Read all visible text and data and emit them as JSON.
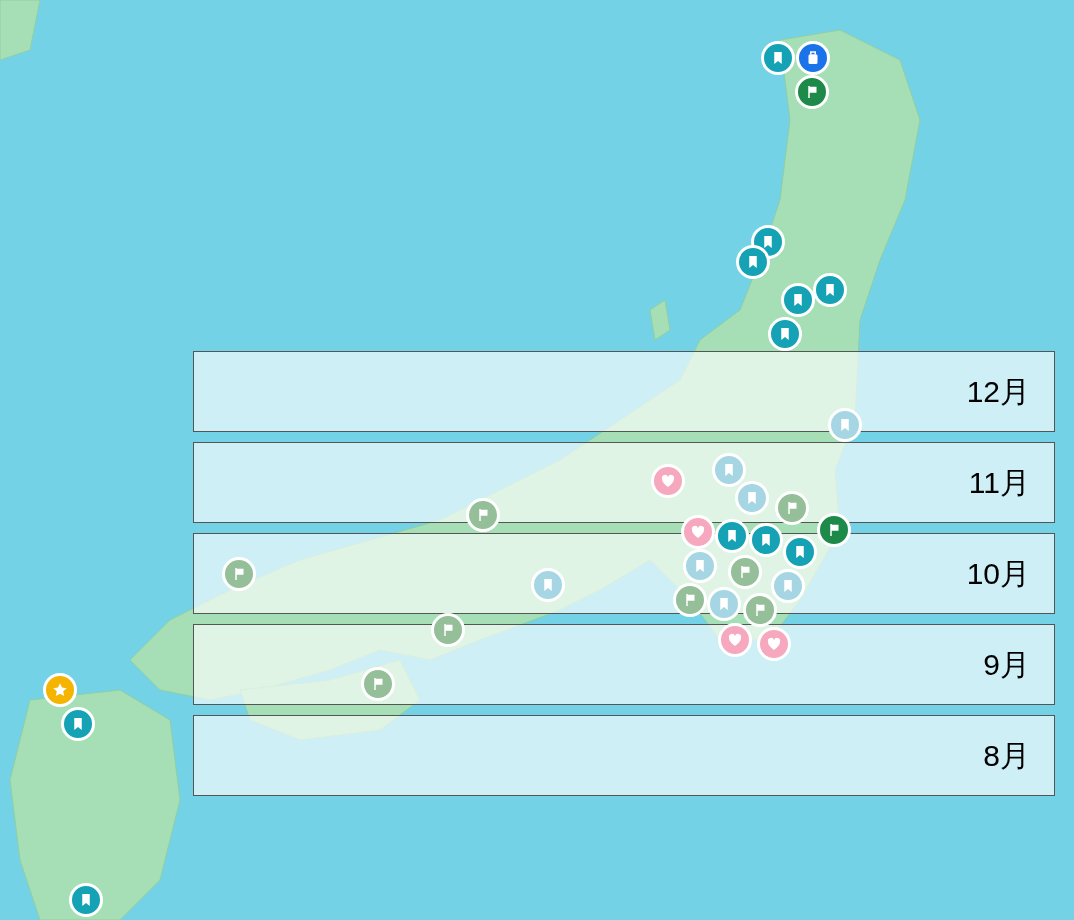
{
  "month_bands": [
    {
      "label": "12月"
    },
    {
      "label": "11月"
    },
    {
      "label": "10月"
    },
    {
      "label": "9月"
    },
    {
      "label": "8月"
    }
  ],
  "pins": [
    {
      "kind": "bookmark",
      "color": "#16a2b5"
    },
    {
      "kind": "flag",
      "color": "#1e8a4a"
    },
    {
      "kind": "suitcase",
      "color": "#1a73e8"
    },
    {
      "kind": "bookmark",
      "color": "#16a2b5"
    },
    {
      "kind": "bookmark",
      "color": "#16a2b5"
    },
    {
      "kind": "bookmark",
      "color": "#16a2b5"
    },
    {
      "kind": "bookmark",
      "color": "#16a2b5"
    },
    {
      "kind": "bookmark",
      "color": "#16a2b5"
    },
    {
      "kind": "bookmark",
      "color": "#a6d6e3"
    },
    {
      "kind": "heart",
      "color": "#f6a8be"
    },
    {
      "kind": "bookmark",
      "color": "#a6d6e3"
    },
    {
      "kind": "bookmark",
      "color": "#a6d6e3"
    },
    {
      "kind": "flag",
      "color": "#94bf99"
    },
    {
      "kind": "flag",
      "color": "#94bf99"
    },
    {
      "kind": "flag",
      "color": "#1e8a4a"
    },
    {
      "kind": "heart",
      "color": "#f6a8be"
    },
    {
      "kind": "bookmark",
      "color": "#16a2b5"
    },
    {
      "kind": "bookmark",
      "color": "#16a2b5"
    },
    {
      "kind": "bookmark",
      "color": "#16a2b5"
    },
    {
      "kind": "flag",
      "color": "#94bf99"
    },
    {
      "kind": "bookmark",
      "color": "#a6d6e3"
    },
    {
      "kind": "bookmark",
      "color": "#a6d6e3"
    },
    {
      "kind": "flag",
      "color": "#94bf99"
    },
    {
      "kind": "bookmark",
      "color": "#a6d6e3"
    },
    {
      "kind": "flag",
      "color": "#94bf99"
    },
    {
      "kind": "heart",
      "color": "#f6a8be"
    },
    {
      "kind": "heart",
      "color": "#f6a8be"
    },
    {
      "kind": "flag",
      "color": "#94bf99"
    },
    {
      "kind": "bookmark",
      "color": "#a6d6e3"
    },
    {
      "kind": "flag",
      "color": "#94bf99"
    },
    {
      "kind": "flag",
      "color": "#94bf99"
    },
    {
      "kind": "star",
      "color": "#f4b400"
    },
    {
      "kind": "bookmark",
      "color": "#16a2b5"
    },
    {
      "kind": "bookmark",
      "color": "#16a2b5"
    }
  ]
}
